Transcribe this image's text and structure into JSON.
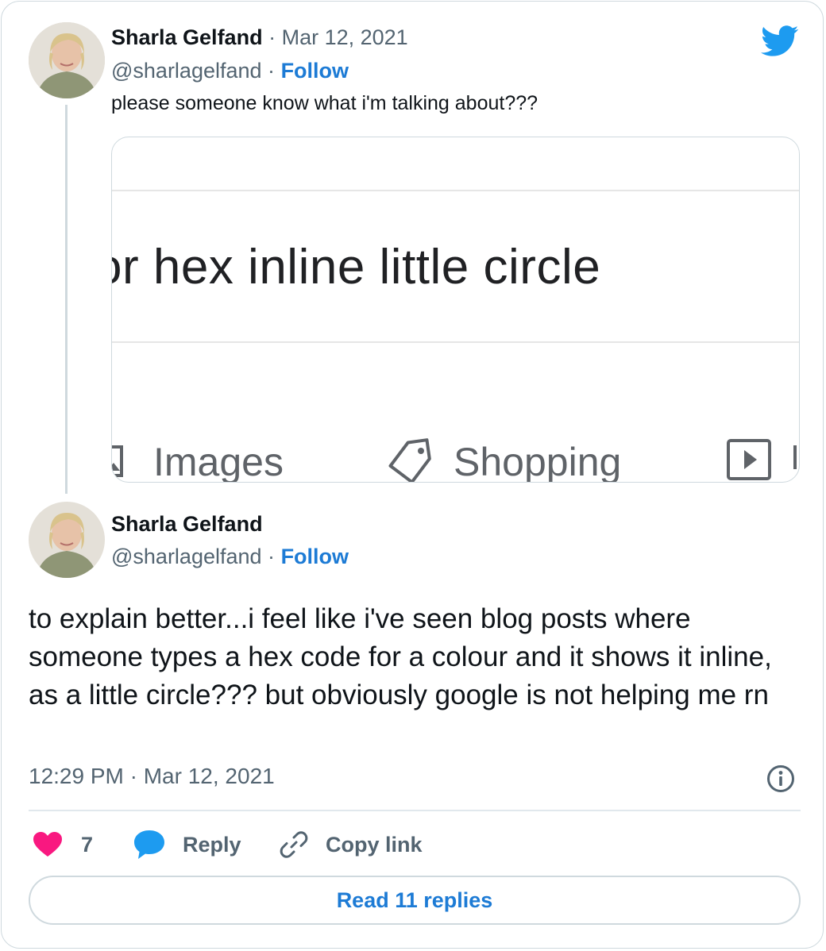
{
  "tweet1": {
    "author_name": "Sharla Gelfand",
    "separator": "·",
    "date": "Mar 12, 2021",
    "handle": "@sharlagelfand",
    "follow_label": "Follow",
    "text": "please someone know what i'm talking about???",
    "media": {
      "query_text": "or hex inline little circle",
      "tabs": [
        "Images",
        "Shopping"
      ]
    }
  },
  "tweet2": {
    "author_name": "Sharla Gelfand",
    "handle": "@sharlagelfand",
    "follow_label": "Follow",
    "text": "to explain better...i feel like i've seen blog posts where someone types a hex code for a colour and it shows it inline, as a little circle??? but obviously google is not helping me rn",
    "timestamp": "12:29 PM · Mar 12, 2021",
    "likes": "7",
    "reply_label": "Reply",
    "copy_link_label": "Copy link",
    "read_replies_label": "Read 11 replies"
  },
  "icons": {
    "brand": "twitter-bird-icon",
    "info": "info-icon",
    "like": "heart-icon",
    "reply": "speech-bubble-icon",
    "copy": "link-icon"
  },
  "colors": {
    "brand_blue": "#1d9bf0",
    "link_blue": "#1d7bd5",
    "like_pink": "#f91880",
    "muted_text": "#536471"
  }
}
